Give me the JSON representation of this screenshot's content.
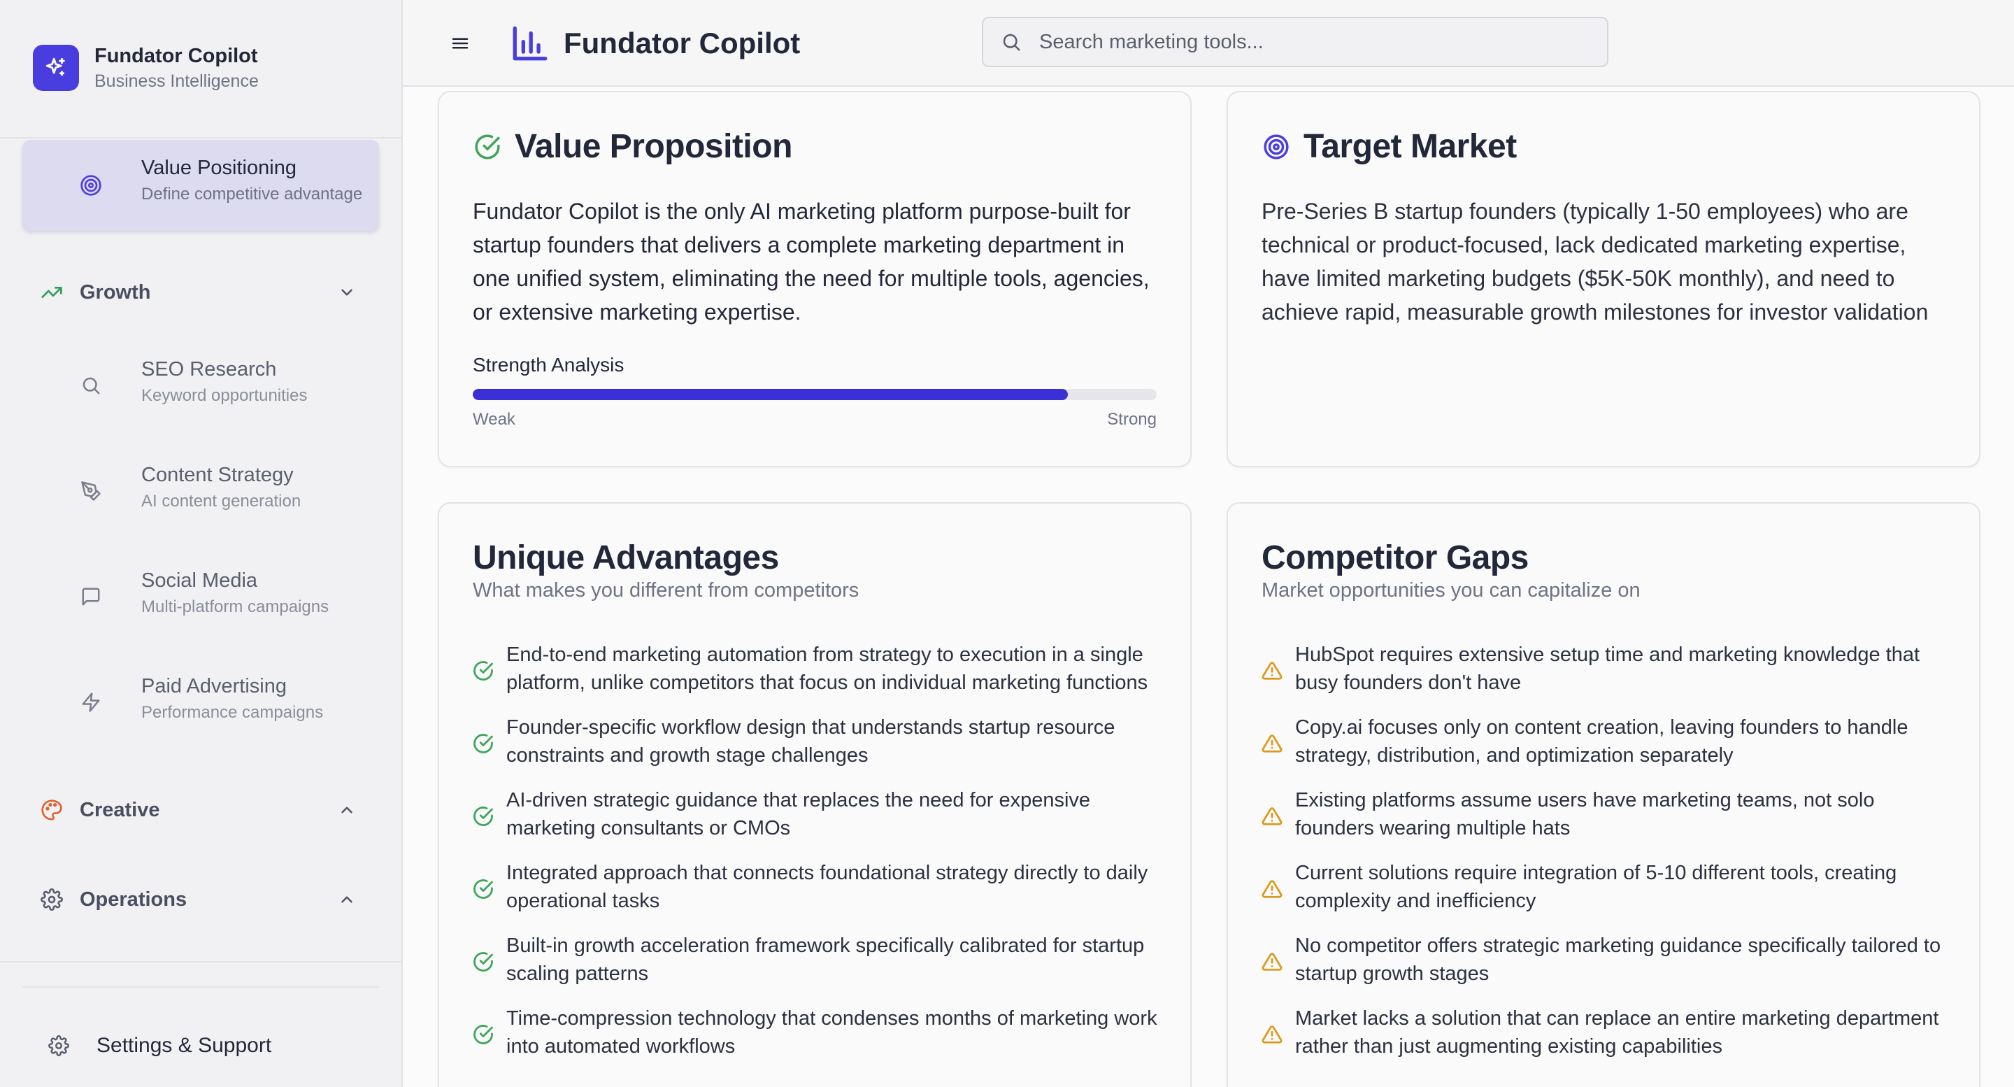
{
  "sidebar": {
    "brand": {
      "title": "Fundator Copilot",
      "subtitle": "Business Intelligence"
    },
    "active_item": {
      "label": "Value Positioning",
      "description": "Define competitive advantage",
      "icon": "target-icon"
    },
    "groups": [
      {
        "label": "Growth",
        "icon": "trending-up-icon",
        "expanded": true,
        "items": [
          {
            "label": "SEO Research",
            "description": "Keyword opportunities",
            "icon": "search-icon"
          },
          {
            "label": "Content Strategy",
            "description": "AI content generation",
            "icon": "pen-tool-icon"
          },
          {
            "label": "Social Media",
            "description": "Multi-platform campaigns",
            "icon": "message-square-icon"
          },
          {
            "label": "Paid Advertising",
            "description": "Performance campaigns",
            "icon": "zap-icon"
          }
        ]
      },
      {
        "label": "Creative",
        "icon": "palette-icon",
        "expanded": false
      },
      {
        "label": "Operations",
        "icon": "gear-icon",
        "expanded": false
      }
    ],
    "footer": {
      "label": "Settings & Support",
      "icon": "gear-icon"
    }
  },
  "topbar": {
    "title": "Fundator Copilot",
    "search_placeholder": "Search marketing tools...",
    "icons": [
      "menu-icon",
      "bar-chart-icon",
      "moon-icon",
      "gear-icon",
      "user-icon"
    ]
  },
  "value_proposition": {
    "title": "Value Proposition",
    "text": "Fundator Copilot is the only AI marketing platform purpose-built for startup founders that delivers a complete marketing department in one unified system, eliminating the need for multiple tools, agencies, or extensive marketing expertise.",
    "strength_label": "Strength Analysis",
    "strength_value": 0.87,
    "min_label": "Weak",
    "max_label": "Strong"
  },
  "target_market": {
    "title": "Target Market",
    "text": "Pre-Series B startup founders (typically 1-50 employees) who are technical or product-focused, lack dedicated marketing expertise, have limited marketing budgets ($5K-50K monthly), and need to achieve rapid, measurable growth milestones for investor validation"
  },
  "unique_advantages": {
    "title": "Unique Advantages",
    "subtitle": "What makes you different from competitors",
    "items": [
      "End-to-end marketing automation from strategy to execution in a single platform, unlike competitors that focus on individual marketing functions",
      "Founder-specific workflow design that understands startup resource constraints and growth stage challenges",
      "AI-driven strategic guidance that replaces the need for expensive marketing consultants or CMOs",
      "Integrated approach that connects foundational strategy directly to daily operational tasks",
      "Built-in growth acceleration framework specifically calibrated for startup scaling patterns",
      "Time-compression technology that condenses months of marketing work into automated workflows"
    ]
  },
  "competitor_gaps": {
    "title": "Competitor Gaps",
    "subtitle": "Market opportunities you can capitalize on",
    "items": [
      "HubSpot requires extensive setup time and marketing knowledge that busy founders don't have",
      "Copy.ai focuses only on content creation, leaving founders to handle strategy, distribution, and optimization separately",
      "Existing platforms assume users have marketing teams, not solo founders wearing multiple hats",
      "Current solutions require integration of 5-10 different tools, creating complexity and inefficiency",
      "No competitor offers strategic marketing guidance specifically tailored to startup growth stages",
      "Market lacks a solution that can replace an entire marketing department rather than just augmenting existing capabilities"
    ]
  },
  "colors": {
    "accent": "#4a3de0",
    "bar_fill": "#3b2fd6",
    "success": "#3fa55a",
    "warning": "#d99a1e",
    "growth": "#2f9e5a",
    "creative": "#e0622e"
  }
}
